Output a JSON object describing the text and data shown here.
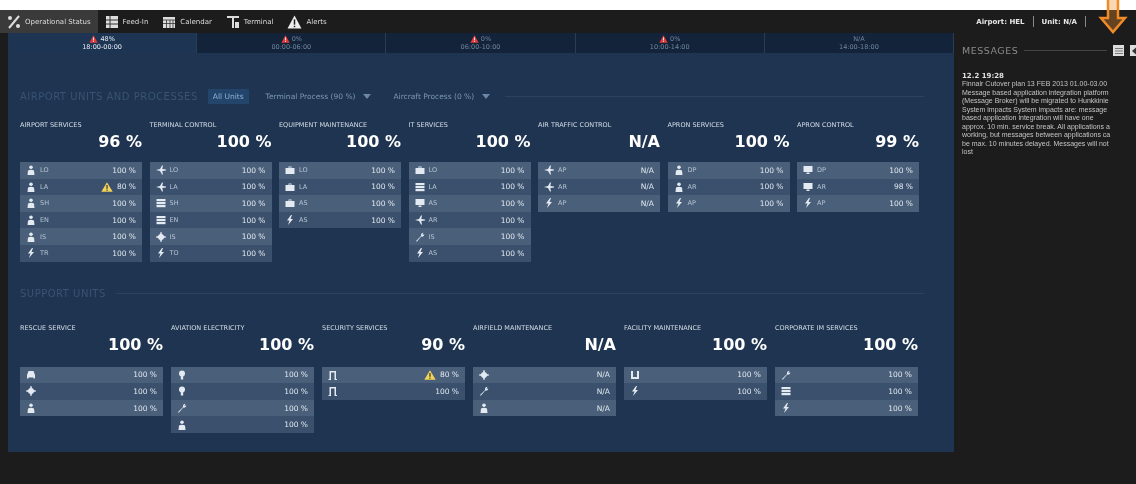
{
  "nav": {
    "items": [
      {
        "label": "Operational Status",
        "selected": true
      },
      {
        "label": "Feed-In",
        "selected": false
      },
      {
        "label": "Calendar",
        "selected": false
      },
      {
        "label": "Terminal",
        "selected": false
      },
      {
        "label": "Alerts",
        "selected": false
      }
    ],
    "airport": "Airport: HEL",
    "unit": "Unit: N/A"
  },
  "time_slots": [
    {
      "value": "48%",
      "range": "18:00-00:00",
      "alert": true,
      "selected": true
    },
    {
      "value": "0%",
      "range": "00:00-06:00",
      "alert": true,
      "selected": false
    },
    {
      "value": "0%",
      "range": "06:00-10:00",
      "alert": true,
      "selected": false
    },
    {
      "value": "0%",
      "range": "10:00-14:00",
      "alert": true,
      "selected": false
    },
    {
      "value": "N/A",
      "range": "14:00-18:00",
      "alert": false,
      "selected": false
    }
  ],
  "sections": [
    {
      "title": "AIRPORT UNITS AND PROCESSES",
      "filters": [
        {
          "label": "All Units",
          "kind": "button",
          "selected": true
        },
        {
          "label": "Terminal Process (90 %)",
          "kind": "dropdown",
          "selected": false
        },
        {
          "label": "Aircraft Process (0 %)",
          "kind": "dropdown",
          "selected": false
        }
      ],
      "units": [
        {
          "name": "AIRPORT SERVICES",
          "value": "96 %",
          "rows": [
            {
              "code": "LO",
              "value": "100 %",
              "warning": false
            },
            {
              "code": "LA",
              "value": "80 %",
              "warning": true
            },
            {
              "code": "SH",
              "value": "100 %",
              "warning": false
            },
            {
              "code": "EN",
              "value": "100 %",
              "warning": false
            },
            {
              "code": "IS",
              "value": "100 %",
              "warning": false
            },
            {
              "code": "TR",
              "value": "100 %",
              "warning": false
            }
          ]
        },
        {
          "name": "TERMINAL CONTROL",
          "value": "100 %",
          "rows": [
            {
              "code": "LO",
              "value": "100 %",
              "warning": false
            },
            {
              "code": "LA",
              "value": "100 %",
              "warning": false
            },
            {
              "code": "SH",
              "value": "100 %",
              "warning": false
            },
            {
              "code": "EN",
              "value": "100 %",
              "warning": false
            },
            {
              "code": "IS",
              "value": "100 %",
              "warning": false
            },
            {
              "code": "TO",
              "value": "100 %",
              "warning": false
            }
          ]
        },
        {
          "name": "EQUIPMENT MAINTENANCE",
          "value": "100 %",
          "rows": [
            {
              "code": "LO",
              "value": "100 %",
              "warning": false
            },
            {
              "code": "LA",
              "value": "100 %",
              "warning": false
            },
            {
              "code": "AS",
              "value": "100 %",
              "warning": false
            },
            {
              "code": "AS",
              "value": "100 %",
              "warning": false
            }
          ]
        },
        {
          "name": "IT SERVICES",
          "value": "100 %",
          "rows": [
            {
              "code": "LO",
              "value": "100 %",
              "warning": false
            },
            {
              "code": "LA",
              "value": "100 %",
              "warning": false
            },
            {
              "code": "AS",
              "value": "100 %",
              "warning": false
            },
            {
              "code": "AR",
              "value": "100 %",
              "warning": false
            },
            {
              "code": "IS",
              "value": "100 %",
              "warning": false
            },
            {
              "code": "AS",
              "value": "100 %",
              "warning": false
            }
          ]
        },
        {
          "name": "AIR TRAFFIC CONTROL",
          "value": "N/A",
          "rows": [
            {
              "code": "AP",
              "value": "N/A",
              "warning": false
            },
            {
              "code": "AR",
              "value": "N/A",
              "warning": false
            },
            {
              "code": "AP",
              "value": "N/A",
              "warning": false
            }
          ]
        },
        {
          "name": "APRON SERVICES",
          "value": "100 %",
          "rows": [
            {
              "code": "DP",
              "value": "100 %",
              "warning": false
            },
            {
              "code": "AR",
              "value": "100 %",
              "warning": false
            },
            {
              "code": "AP",
              "value": "100 %",
              "warning": false
            }
          ]
        },
        {
          "name": "APRON CONTROL",
          "value": "99 %",
          "rows": [
            {
              "code": "DP",
              "value": "100 %",
              "warning": false
            },
            {
              "code": "AR",
              "value": "98 %",
              "warning": false
            },
            {
              "code": "AP",
              "value": "100 %",
              "warning": false
            }
          ]
        }
      ]
    },
    {
      "title": "SUPPORT UNITS",
      "units": [
        {
          "name": "RESCUE SERVICE",
          "value": "100 %",
          "rows": [
            {
              "value": "100 %",
              "warning": false
            },
            {
              "value": "100 %",
              "warning": false
            },
            {
              "value": "100 %",
              "warning": false
            }
          ]
        },
        {
          "name": "AVIATION ELECTRICITY",
          "value": "100 %",
          "rows": [
            {
              "value": "100 %",
              "warning": false
            },
            {
              "value": "100 %",
              "warning": false
            },
            {
              "value": "100 %",
              "warning": false
            },
            {
              "value": "100 %",
              "warning": false
            }
          ]
        },
        {
          "name": "SECURITY SERVICES",
          "value": "90 %",
          "rows": [
            {
              "value": "80 %",
              "warning": true
            },
            {
              "value": "100 %",
              "warning": false
            }
          ]
        },
        {
          "name": "AIRFIELD MAINTENANCE",
          "value": "N/A",
          "rows": [
            {
              "value": "N/A",
              "warning": false
            },
            {
              "value": "N/A",
              "warning": false
            },
            {
              "value": "N/A",
              "warning": false
            }
          ]
        },
        {
          "name": "FACILITY MAINTENANCE",
          "value": "100 %",
          "rows": [
            {
              "value": "100 %",
              "warning": false
            },
            {
              "value": "100 %",
              "warning": false
            }
          ]
        },
        {
          "name": "CORPORATE IM SERVICES",
          "value": "100 %",
          "rows": [
            {
              "value": "100 %",
              "warning": false
            },
            {
              "value": "100 %",
              "warning": false
            },
            {
              "value": "100 %",
              "warning": false
            }
          ]
        }
      ]
    }
  ],
  "messages": {
    "title": "MESSAGES",
    "items": [
      {
        "time": "12.2 19:28",
        "lines": [
          "Finnair Cutover plan 13 FEB 2013 01.00-03.00",
          "Message based application integration platform",
          "(Message Broker) will be migrated to Hunkkinie",
          "System impacts System impacts are: message",
          "based application integration will have one",
          "approx. 10 min. service break. All applications a",
          "working, but messages between applications ca",
          "be max. 10 minutes delayed. Messages will not",
          "lost"
        ]
      }
    ]
  }
}
